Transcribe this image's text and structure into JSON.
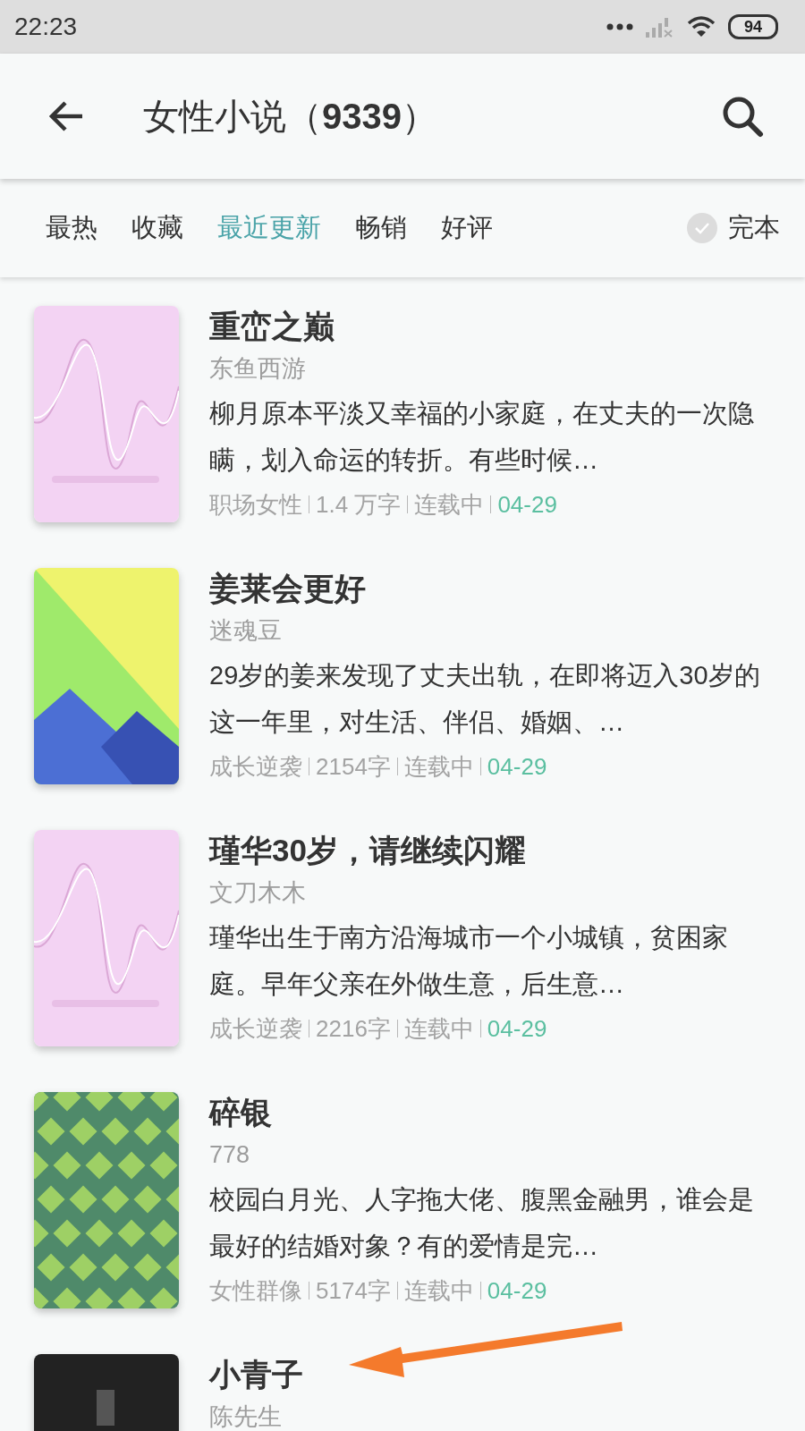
{
  "status_bar": {
    "time": "22:23",
    "battery": "94"
  },
  "header": {
    "title": "女性小说（**9339**）"
  },
  "tabs": [
    {
      "label": "最热",
      "selected": false
    },
    {
      "label": "收藏",
      "selected": false
    },
    {
      "label": "最近更新",
      "selected": true
    },
    {
      "label": "畅销",
      "selected": false
    },
    {
      "label": "好评",
      "selected": false
    }
  ],
  "finished_filter": {
    "label": "完本",
    "checked": false
  },
  "books": [
    {
      "title": "重峦之巅",
      "author": "东鱼西游",
      "description": "柳月原本平淡又幸福的小家庭，在丈夫的一次隐瞒，划入命运的转折。有些时候…",
      "category": "职场女性",
      "words": "1.4 万字",
      "status": "连载中",
      "date": "04-29"
    },
    {
      "title": "姜莱会更好",
      "author": "迷魂豆",
      "description": "29岁的姜来发现了丈夫出轨，在即将迈入30岁的这一年里，对生活、伴侣、婚姻、…",
      "category": "成长逆袭",
      "words": "2154字",
      "status": "连载中",
      "date": "04-29"
    },
    {
      "title": "瑾华30岁，请继续闪耀",
      "author": "文刀木木",
      "description": "瑾华出生于南方沿海城市一个小城镇，贫困家庭。早年父亲在外做生意，后生意…",
      "category": "成长逆袭",
      "words": "2216字",
      "status": "连载中",
      "date": "04-29"
    },
    {
      "title": "碎银",
      "author": "778",
      "description": "校园白月光、人字拖大佬、腹黑金融男，谁会是最好的结婚对象？有的爱情是完…",
      "category": "女性群像",
      "words": "5174字",
      "status": "连载中",
      "date": "04-29"
    },
    {
      "title": "小青子",
      "author": "陈先生"
    }
  ]
}
